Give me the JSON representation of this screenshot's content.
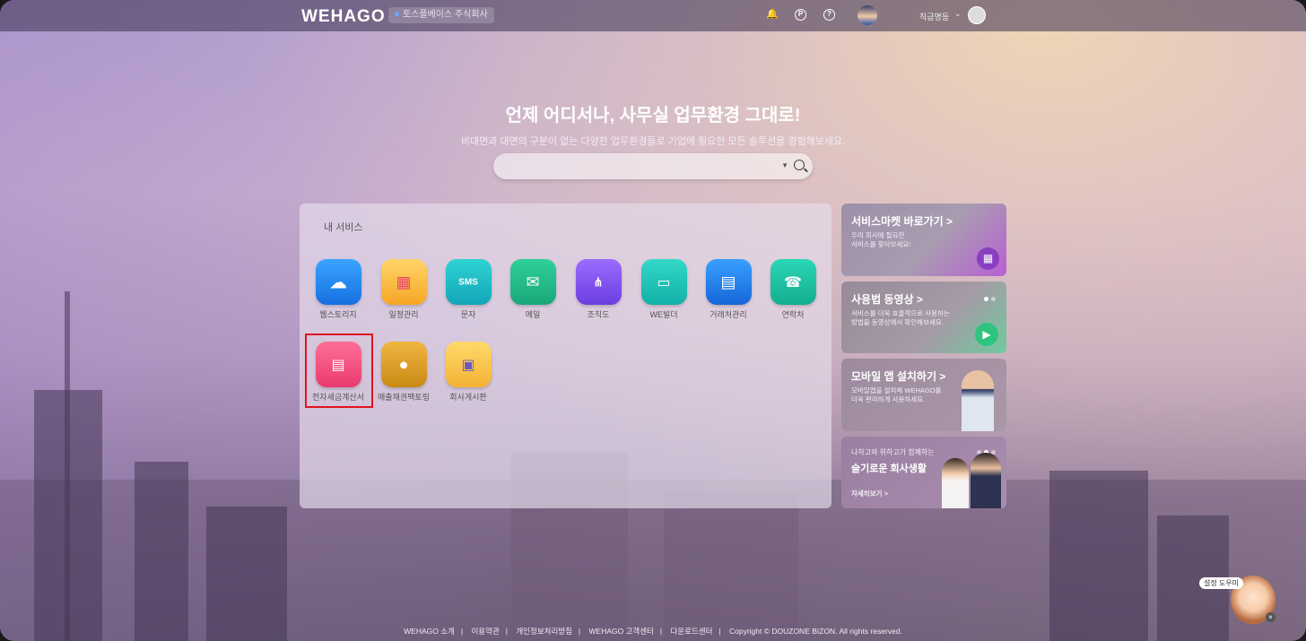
{
  "topbar": {
    "logo": "WEHAGO",
    "company": "토스플베이스 주식회사",
    "username": "직급명등"
  },
  "hero": {
    "title": "언제 어디서나, 사무실 업무환경 그대로!",
    "subtitle": "비대면과 대면의 구분이 없는 다양한 업무환경들로 기업에 필요한 모든 솔루션을 경험해보세요.",
    "search_placeholder": ""
  },
  "services": {
    "title": "내 서비스",
    "apps": [
      {
        "label": "웹스토리지",
        "icon": "cloud-storage-icon"
      },
      {
        "label": "일정관리",
        "icon": "calendar-icon"
      },
      {
        "label": "문자",
        "icon": "sms-icon"
      },
      {
        "label": "메일",
        "icon": "mail-icon"
      },
      {
        "label": "조직도",
        "icon": "org-chart-icon"
      },
      {
        "label": "WE빌더",
        "icon": "we-builder-icon"
      },
      {
        "label": "거래처관리",
        "icon": "client-building-icon"
      },
      {
        "label": "연락처",
        "icon": "contacts-phone-icon"
      },
      {
        "label": "전자세금계산서",
        "icon": "e-tax-invoice-icon"
      },
      {
        "label": "매출채권팩토링",
        "icon": "factoring-toad-icon"
      },
      {
        "label": "회사게시판",
        "icon": "company-board-icon"
      }
    ]
  },
  "cards": [
    {
      "title": "서비스마켓 바로가기 >",
      "desc1": "우리 회사에 필요한",
      "desc2": "서비스를 찾아보세요!"
    },
    {
      "title": "사용법 동영상 >",
      "desc1": "서비스를 더욱 효율적으로 사용하는",
      "desc2": "방법을 동영상에서 확인해보세요."
    },
    {
      "title": "모바일 앱 설치하기 >",
      "desc1": "모바일앱을 설치해 WEHAGO를",
      "desc2": "더욱 편리하게 사용하세요."
    },
    {
      "title_top": "나하고와 위하고가 함께하는",
      "title": "슬기로운 회사생활",
      "link": "자세히보기 >"
    }
  ],
  "footer": {
    "links": [
      "WEHAGO 소개",
      "이용약관",
      "개인정보처리방침",
      "WEHAGO 고객센터",
      "다운로드센터"
    ],
    "copyright": "Copyright © DOUZONE BIZON. All rights reserved."
  },
  "helper": {
    "label": "설정 도우미"
  }
}
